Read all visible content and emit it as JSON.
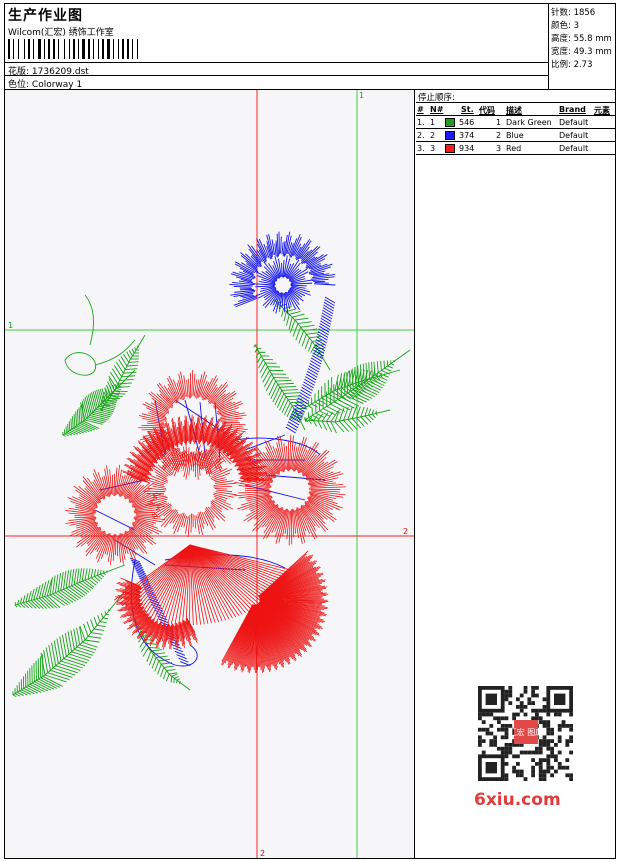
{
  "header": {
    "title": "生产作业图",
    "company": "Wilcom(汇宏) 绣饰工作室",
    "design_label": "花版:",
    "design_value": "1736209.dst",
    "colorway_label": "色位:",
    "colorway_value": "Colorway 1"
  },
  "stats": {
    "stitches": "针数: 1856",
    "colors": "颜色: 3",
    "height": "高度: 55.8 mm",
    "width": "宽度: 49.3 mm",
    "scale": "比例: 2.73"
  },
  "stop_sequence": {
    "title": "停止顺序:",
    "columns": [
      "#",
      "N#",
      "St.",
      "代码",
      "描述",
      "Brand",
      "元素"
    ],
    "rows": [
      {
        "index": "1.",
        "n": "1",
        "stitches": "546",
        "code": "1",
        "description": "Dark Green",
        "brand": "Default",
        "color": "#1aa01a"
      },
      {
        "index": "2.",
        "n": "2",
        "stitches": "374",
        "code": "2",
        "description": "Blue",
        "brand": "Default",
        "color": "#1a1aff"
      },
      {
        "index": "3.",
        "n": "3",
        "stitches": "934",
        "code": "3",
        "description": "Red",
        "brand": "Default",
        "color": "#ff1a1a"
      }
    ]
  },
  "guides": {
    "green_v_label": "1",
    "green_h_label": "1",
    "red_h_label": "2",
    "red_v_label": "2"
  },
  "watermark": {
    "stamp": "汇宏 图库",
    "site": "6xiu.com"
  }
}
